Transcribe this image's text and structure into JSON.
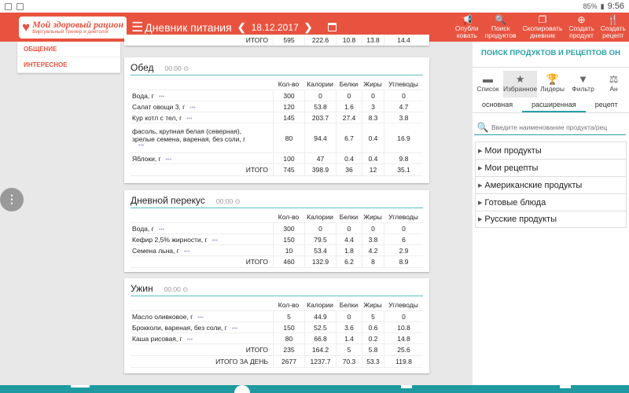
{
  "statusbar": {
    "battery": "85%",
    "time": "9:56"
  },
  "logo": {
    "line1": "Мой здоровый рацион",
    "line2": "Виртуальный тренер и диетолог"
  },
  "header": {
    "title": "Дневник питания",
    "date": "18.12.2017"
  },
  "actions": [
    {
      "l1": "Опубли",
      "l2": "ковать",
      "icon": "megaphone-icon",
      "glyph": "📢"
    },
    {
      "l1": "Поиск",
      "l2": "продуктов",
      "icon": "search-icon",
      "glyph": "🔍"
    },
    {
      "l1": "Скопировать",
      "l2": "дневник",
      "icon": "copy-icon",
      "glyph": "❐"
    },
    {
      "l1": "Создать",
      "l2": "продукт",
      "icon": "add-product-icon",
      "glyph": "⊕"
    },
    {
      "l1": "Создать",
      "l2": "рецепт",
      "icon": "fork-knife-icon",
      "glyph": "🍴"
    }
  ],
  "leftmenu": {
    "item1": "ОБЩЕНИЕ",
    "item2": "ИНТЕРЕСНОЕ"
  },
  "top_partial_total": {
    "label": "ИТОГО",
    "values": [
      "595",
      "222.6",
      "10.8",
      "13.8",
      "14.4"
    ]
  },
  "columns": [
    "Кол-во",
    "Калории",
    "Белки",
    "Жиры",
    "Углеводы"
  ],
  "meals": {
    "lunch": {
      "title": "Обед",
      "time": "00:00",
      "items": [
        {
          "name": "Вода, г",
          "v": [
            "300",
            "0",
            "0",
            "0",
            "0"
          ]
        },
        {
          "name": "Салат овощи 3, г",
          "v": [
            "120",
            "53.8",
            "1.6",
            "3",
            "4.7"
          ]
        },
        {
          "name": "Кур котл с тел, г",
          "v": [
            "145",
            "203.7",
            "27.4",
            "8.3",
            "3.8"
          ]
        },
        {
          "name1": "фасоль, крупная белая (северная),",
          "name2": "зрелые семена, вареная, без соли, г",
          "v": [
            "80",
            "94.4",
            "6.7",
            "0.4",
            "16.9"
          ]
        },
        {
          "name": "Яблоки, г",
          "v": [
            "100",
            "47",
            "0.4",
            "0.4",
            "9.8"
          ]
        }
      ],
      "total": {
        "label": "ИТОГО",
        "v": [
          "745",
          "398.9",
          "36",
          "12",
          "35.1"
        ]
      }
    },
    "snack": {
      "title": "Дневной перекус",
      "time": "00:00",
      "items": [
        {
          "name": "Вода, г",
          "v": [
            "300",
            "0",
            "0",
            "0",
            "0"
          ]
        },
        {
          "name": "Кефир 2,5% жирности, г",
          "v": [
            "150",
            "79.5",
            "4.4",
            "3.8",
            "6"
          ]
        },
        {
          "name": "Семена льна, г",
          "v": [
            "10",
            "53.4",
            "1.8",
            "4.2",
            "2.9"
          ]
        }
      ],
      "total": {
        "label": "ИТОГО",
        "v": [
          "460",
          "132.9",
          "6.2",
          "8",
          "8.9"
        ]
      }
    },
    "dinner": {
      "title": "Ужин",
      "time": "00:00",
      "items": [
        {
          "name": "Масло оливковое, г",
          "v": [
            "5",
            "44.9",
            "0",
            "5",
            "0"
          ]
        },
        {
          "name": "Брокколи, вареная, без соли, г",
          "v": [
            "150",
            "52.5",
            "3.6",
            "0.6",
            "10.8"
          ]
        },
        {
          "name": "Каша рисовая, г",
          "v": [
            "80",
            "66.8",
            "1.4",
            "0.2",
            "14.8"
          ]
        }
      ],
      "total": {
        "label": "ИТОГО",
        "v": [
          "235",
          "164.2",
          "5",
          "5.8",
          "25.6"
        ]
      },
      "daytotal": {
        "label": "ИТОГО ЗА ДЕНЬ",
        "v": [
          "2677",
          "1237.7",
          "70.3",
          "53.3",
          "119.8"
        ]
      }
    }
  },
  "right": {
    "title": "ПОИСК ПРОДУКТОВ И РЕЦЕПТОВ ОН",
    "tabs": [
      {
        "label": "Список",
        "icon": "folder-icon",
        "glyph": "▬"
      },
      {
        "label": "Избранное",
        "icon": "star-icon",
        "glyph": "★"
      },
      {
        "label": "Лидеры",
        "icon": "trophy-icon",
        "glyph": "🏆"
      },
      {
        "label": "Фильтр",
        "icon": "filter-icon",
        "glyph": "▼"
      },
      {
        "label": "Ан",
        "icon": "scales-icon",
        "glyph": "⚖"
      }
    ],
    "subtabs": [
      "основная",
      "расширенная",
      "рецепт"
    ],
    "search_placeholder": "Введите наименование продукта/рец",
    "categories": [
      "Мои продукты",
      "Мои рецепты",
      "Американские продукты",
      "Готовые блюда",
      "Русские продукты"
    ]
  }
}
